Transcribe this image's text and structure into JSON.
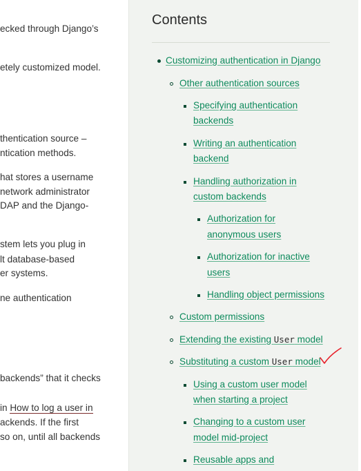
{
  "main_text": {
    "lines": [
      "ecked through Django’s",
      "etely customized model.",
      "thentication source –",
      "ntication methods.",
      "hat stores a username",
      " network administrator",
      "DAP and the Django-",
      "stem lets you plug in",
      "lt database-based",
      "er systems.",
      "ne authentication",
      "backends” that it checks",
      "ackends. If the first",
      "so on, until all backends"
    ],
    "how_to_prefix": "in ",
    "how_to_link": "How to log a user in"
  },
  "sidebar": {
    "title": "Contents",
    "items": [
      {
        "label": "Customizing authentication in Django"
      },
      {
        "label": "Other authentication sources"
      },
      {
        "line1": "Specifying authentication",
        "line2": "backends"
      },
      {
        "line1": "Writing an authentication",
        "line2": "backend"
      },
      {
        "line1": "Handling authorization in",
        "line2": "custom backends"
      },
      {
        "line1": "Authorization for",
        "line2": "anonymous users"
      },
      {
        "line1": "Authorization for inactive",
        "line2": "users"
      },
      {
        "label": "Handling object permissions"
      },
      {
        "label": "Custom permissions"
      },
      {
        "prefix": "Extending the existing ",
        "code": "User",
        "suffix": " model"
      },
      {
        "prefix": "Substituting a custom ",
        "code": "User",
        "suffix": " model"
      },
      {
        "line1": "Using a custom user model",
        "line2": "when starting a project"
      },
      {
        "line1": "Changing to a custom user",
        "line2": "model mid-project"
      },
      {
        "line1": "Reusable apps and"
      }
    ]
  },
  "colors": {
    "link": "#0d8a5c",
    "bullet": "#0c4b33",
    "sidebar_bg": "#f1f3f0",
    "annotation": "#e8212b"
  },
  "annotation": {
    "icon": "red-checkmark-icon"
  }
}
